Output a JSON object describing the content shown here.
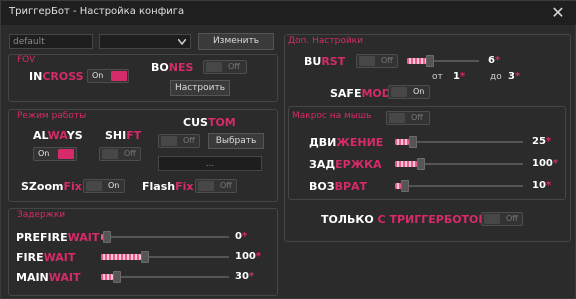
{
  "window": {
    "title": "ТриггерБот - Настройка конфига",
    "close": "✕"
  },
  "config": {
    "current": "default",
    "selected": "",
    "change_btn": "Изменить"
  },
  "fov": {
    "title": "FOV",
    "incross": {
      "a": "IN",
      "b": "CROSS",
      "state": "On"
    },
    "bones": {
      "a": "BO",
      "b": "NES",
      "state": "Off",
      "setup_btn": "Настроить"
    }
  },
  "mode": {
    "title": "Режим работы",
    "always": {
      "a": "AL",
      "b": "WA",
      "c": "YS",
      "state": "On"
    },
    "shift": {
      "a": "SHI",
      "b": "FT",
      "state": "Off"
    },
    "custom": {
      "a": "CUS",
      "b": "TOM",
      "state": "Off",
      "choose_btn": "Выбрать",
      "key_field": "..."
    },
    "szoom": {
      "a": "SZoom",
      "b": "Fix",
      "state": "On"
    },
    "flash": {
      "a": "Flash",
      "b": "Fix",
      "state": "Off"
    }
  },
  "delays": {
    "title": "Задержки",
    "rows": [
      {
        "a": "PREFIRE",
        "b": "WAIT",
        "value": "0",
        "unit": "*",
        "fraction": 0.0
      },
      {
        "a": "FIRE",
        "b": "WAIT",
        "value": "100",
        "unit": "*",
        "fraction": 0.33
      },
      {
        "a": "MAIN",
        "b": "WAIT",
        "value": "30",
        "unit": "*",
        "fraction": 0.1
      }
    ]
  },
  "extra": {
    "title": "Доп. Настройки",
    "burst": {
      "a": "BU",
      "b": "RST",
      "state": "Off",
      "value": "6",
      "unit": "*",
      "fraction": 0.3
    },
    "safemode": {
      "a": "SAFE",
      "b": "MODE",
      "state": "On",
      "from_label": "от",
      "from_value": "1",
      "to_label": "до",
      "to_value": "3",
      "unit": "*"
    }
  },
  "mouse": {
    "title": "Макрос на мышь",
    "state": "Off",
    "rows": [
      {
        "a": "ДВИ",
        "b": "ЖЕНИЕ",
        "value": "25",
        "unit": "*",
        "fraction": 0.12
      },
      {
        "a": "ЗАД",
        "b": "ЕРЖКА",
        "value": "100",
        "unit": "*",
        "fraction": 0.18
      },
      {
        "a": "ВОЗ",
        "b": "ВРАТ",
        "value": "10",
        "unit": "*",
        "fraction": 0.05
      }
    ],
    "only": {
      "a": "ТОЛЬКО ",
      "b": "С ТРИГГЕРБОТОМ",
      "state": "Off"
    }
  },
  "colors": {
    "accent": "#d62b6a",
    "bg": "#2b2b2b",
    "titlebar": "#1f1f1f"
  },
  "icons": {
    "dropdown": "chevron-down-icon",
    "close": "close-icon"
  }
}
